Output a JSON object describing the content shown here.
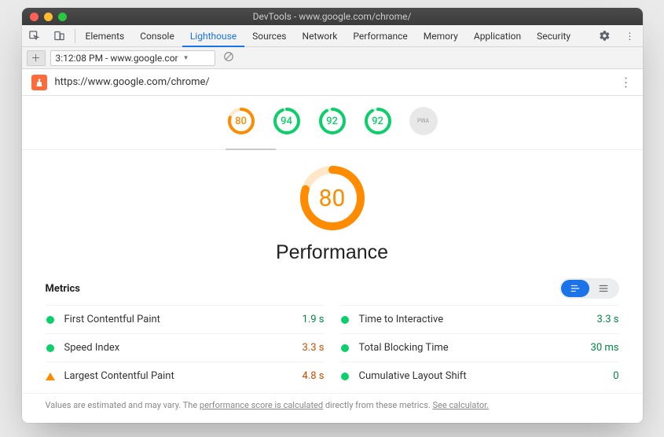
{
  "window": {
    "title": "DevTools - www.google.com/chrome/"
  },
  "tabs": {
    "items": [
      "Elements",
      "Console",
      "Lighthouse",
      "Sources",
      "Network",
      "Performance",
      "Memory",
      "Application",
      "Security"
    ],
    "active": "Lighthouse"
  },
  "toolbar": {
    "selector_label": "3:12:08 PM - www.google.cor"
  },
  "urlbar": {
    "url": "https://www.google.com/chrome/"
  },
  "summary_gauges": [
    {
      "value": 80,
      "color": "orange",
      "frac": 0.8
    },
    {
      "value": 94,
      "color": "green",
      "frac": 0.94
    },
    {
      "value": 92,
      "color": "green",
      "frac": 0.92
    },
    {
      "value": 92,
      "color": "green",
      "frac": 0.92
    }
  ],
  "pwa_label": "PWA",
  "main": {
    "score": 80,
    "frac": 0.8,
    "title": "Performance"
  },
  "metrics": {
    "heading": "Metrics",
    "rows": [
      {
        "name": "First Contentful Paint",
        "value": "1.9 s",
        "status": "green",
        "vclass": "green"
      },
      {
        "name": "Time to Interactive",
        "value": "3.3 s",
        "status": "green",
        "vclass": "green"
      },
      {
        "name": "Speed Index",
        "value": "3.3 s",
        "status": "green",
        "vclass": "orange"
      },
      {
        "name": "Total Blocking Time",
        "value": "30 ms",
        "status": "green",
        "vclass": "green"
      },
      {
        "name": "Largest Contentful Paint",
        "value": "4.8 s",
        "status": "orange",
        "vclass": "orange"
      },
      {
        "name": "Cumulative Layout Shift",
        "value": "0",
        "status": "green",
        "vclass": "green"
      }
    ]
  },
  "footnote": {
    "pre": "Values are estimated and may vary. The ",
    "link1": "performance score is calculated",
    "mid": " directly from these metrics. ",
    "link2": "See calculator."
  }
}
